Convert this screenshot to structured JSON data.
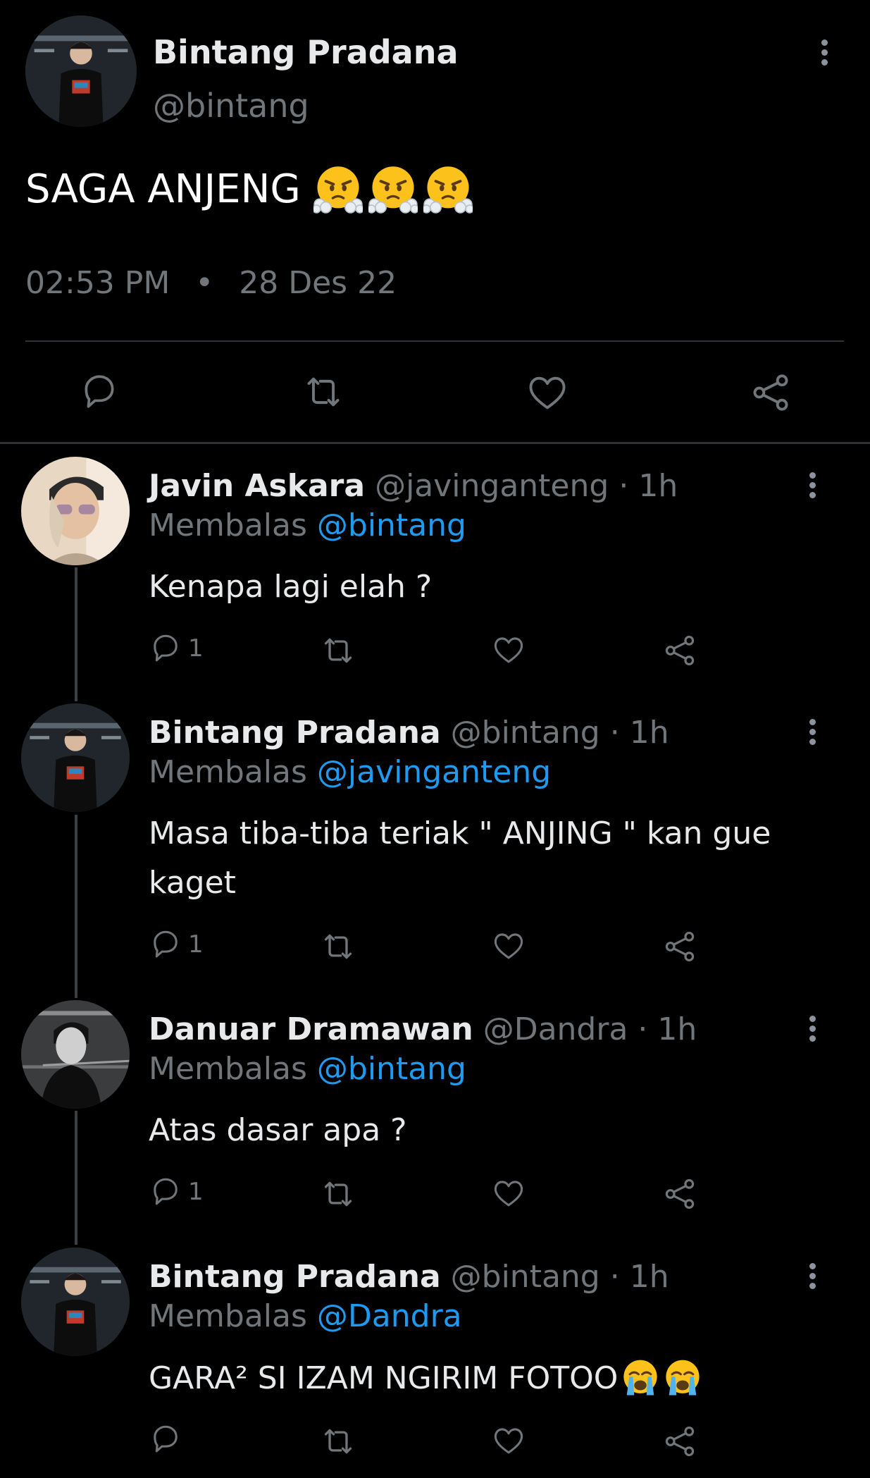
{
  "main": {
    "display_name": "Bintang Pradana",
    "handle": "@bintang",
    "text": "SAGA ANJENG",
    "emoji": [
      "face-with-steam",
      "face-with-steam",
      "face-with-steam"
    ],
    "time": "02:53 PM",
    "separator": "•",
    "date": "28 Des 22"
  },
  "labels": {
    "replying_to": "Membalas",
    "dot": "·"
  },
  "replies": [
    {
      "display_name": "Javin Askara",
      "handle": "@javinganteng",
      "time": "1h",
      "reply_to": "@bintang",
      "text": "Kenapa lagi elah ?",
      "reply_count": "1"
    },
    {
      "display_name": "Bintang Pradana",
      "handle": "@bintang",
      "time": "1h",
      "reply_to": "@javinganteng",
      "text": "Masa tiba-tiba teriak \" ANJING \" kan gue kaget",
      "reply_count": "1"
    },
    {
      "display_name": "Danuar Dramawan",
      "handle": "@Dandra",
      "time": "1h",
      "reply_to": "@bintang",
      "text": "Atas dasar apa ?",
      "reply_count": "1"
    },
    {
      "display_name": "Bintang Pradana",
      "handle": "@bintang",
      "time": "1h",
      "reply_to": "@Dandra",
      "text": "GARA² SI IZAM NGIRIM FOTOO",
      "emoji": [
        "loudly-crying-face",
        "loudly-crying-face"
      ],
      "reply_count": ""
    }
  ],
  "colors": {
    "background": "#000000",
    "text": "#e7e9ea",
    "muted": "#71767b",
    "link": "#1d9bf0",
    "divider": "#2f3336"
  },
  "icons": [
    "comment-icon",
    "retweet-icon",
    "like-icon",
    "share-icon",
    "more-icon"
  ]
}
